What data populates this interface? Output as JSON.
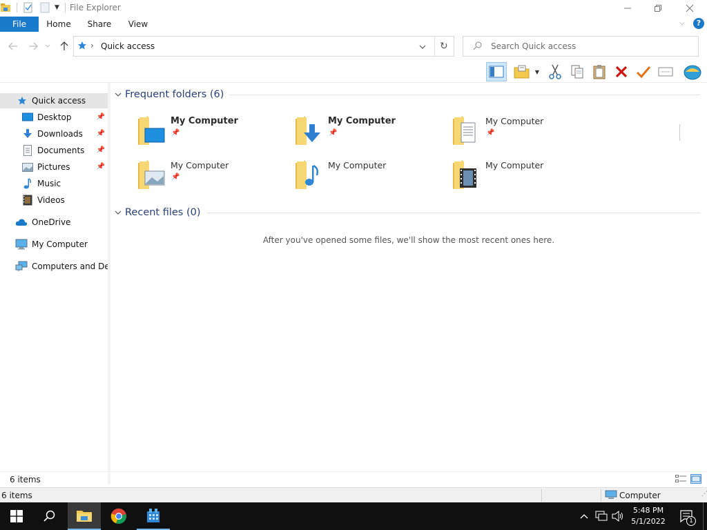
{
  "window": {
    "title": "File Explorer"
  },
  "ribbon": {
    "tabs": [
      "File",
      "Home",
      "Share",
      "View"
    ]
  },
  "address": {
    "location": "Quick access",
    "separator": "›"
  },
  "search": {
    "placeholder": "Search Quick access"
  },
  "nav": {
    "items": [
      {
        "label": "Quick access",
        "icon": "star-icon"
      },
      {
        "label": "Desktop",
        "icon": "desktop-icon",
        "pinned": true
      },
      {
        "label": "Downloads",
        "icon": "download-icon",
        "pinned": true
      },
      {
        "label": "Documents",
        "icon": "document-icon",
        "pinned": true
      },
      {
        "label": "Pictures",
        "icon": "picture-icon",
        "pinned": true
      },
      {
        "label": "Music",
        "icon": "music-icon"
      },
      {
        "label": "Videos",
        "icon": "video-icon"
      },
      {
        "label": "OneDrive",
        "icon": "cloud-icon"
      },
      {
        "label": "My Computer",
        "icon": "computer-icon"
      },
      {
        "label": "Computers and Devices",
        "icon": "network-icon"
      }
    ]
  },
  "content": {
    "frequent": {
      "title": "Frequent folders (6)",
      "folders": [
        {
          "name": "My Computer",
          "overlay": "desktop",
          "pinned": true,
          "bold": true
        },
        {
          "name": "My Computer",
          "overlay": "download",
          "pinned": true,
          "bold": true
        },
        {
          "name": "My Computer",
          "overlay": "document",
          "pinned": true,
          "bold": false
        },
        {
          "name": "My Computer",
          "overlay": "picture",
          "pinned": true,
          "bold": false
        },
        {
          "name": "My Computer",
          "overlay": "music",
          "pinned": false,
          "bold": false
        },
        {
          "name": "My Computer",
          "overlay": "video",
          "pinned": false,
          "bold": false
        }
      ]
    },
    "recent": {
      "title": "Recent files (0)",
      "empty_message": "After you've opened some files, we'll show the most recent ones here."
    }
  },
  "status": {
    "item_count": "6 items",
    "item_count_2": "6 items",
    "zone_label": "Computer"
  },
  "taskbar": {
    "time": "5:48 PM",
    "date": "5/1/2022",
    "notification_count": "1"
  },
  "colors": {
    "accent": "#1979ca",
    "folder": "#f7d774",
    "taskbar": "#101010",
    "nav_selected": "#e5e5e5"
  }
}
